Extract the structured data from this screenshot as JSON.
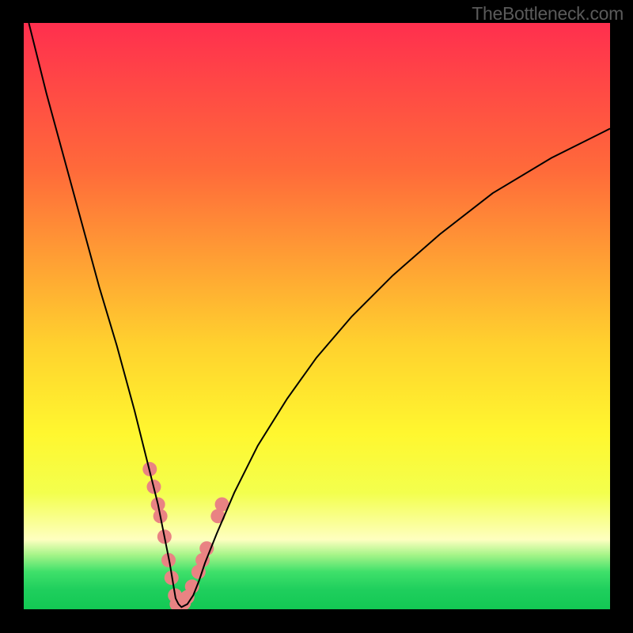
{
  "watermark": "TheBottleneck.com",
  "colors": {
    "curve": "#000000",
    "dots": "#e98383",
    "grad_top": "#ff2f4e",
    "grad_mid1": "#ff6a3a",
    "grad_mid2": "#ffd22e",
    "grad_mid3": "#fff72f",
    "grad_mid4": "#f3ff4d",
    "grad_pale": "#feffc0",
    "grad_green1": "#a9f58a",
    "grad_green2": "#3fe06a",
    "grad_green3": "#1fcf5d",
    "grad_green4": "#12c853",
    "axis": "#000000"
  },
  "chart_data": {
    "type": "line",
    "title": "",
    "xlabel": "",
    "ylabel": "",
    "xlim": [
      0,
      100
    ],
    "ylim": [
      0,
      100
    ],
    "series": [
      {
        "name": "curve",
        "x": [
          1,
          4,
          7,
          10,
          13,
          16,
          19,
          21,
          22,
          23,
          24,
          25,
          25.5,
          26,
          26.5,
          27,
          28,
          29,
          30,
          31,
          33,
          36,
          40,
          45,
          50,
          56,
          63,
          71,
          80,
          90,
          100
        ],
        "y": [
          100,
          88,
          77,
          66,
          55,
          45,
          34,
          26,
          22,
          18,
          13,
          8,
          5,
          2,
          1,
          0.5,
          1,
          2.5,
          5,
          8,
          13,
          20,
          28,
          36,
          43,
          50,
          57,
          64,
          71,
          77,
          82
        ]
      }
    ],
    "dots": {
      "name": "highlight-points",
      "x": [
        21.6,
        22.3,
        23.0,
        23.4,
        24.1,
        24.8,
        25.3,
        25.9,
        26.2,
        26.7,
        27.4,
        28.0,
        28.8,
        29.9,
        30.6,
        31.3,
        33.2,
        33.9
      ],
      "y": [
        24.0,
        21.0,
        18.0,
        16.0,
        12.5,
        8.5,
        5.5,
        2.5,
        1.0,
        0.6,
        1.2,
        2.2,
        4.0,
        6.5,
        8.5,
        10.5,
        16.0,
        18.0
      ]
    },
    "legend": false,
    "grid": false
  }
}
